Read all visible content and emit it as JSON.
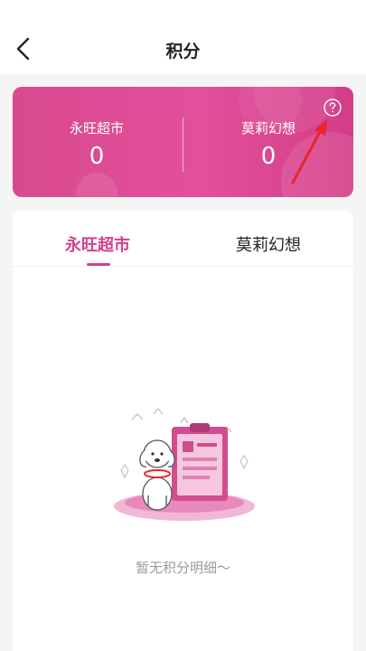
{
  "header": {
    "title": "积分"
  },
  "points_card": {
    "stores": [
      {
        "name": "永旺超市",
        "points": "0"
      },
      {
        "name": "莫莉幻想",
        "points": "0"
      }
    ]
  },
  "tabs": [
    {
      "label": "永旺超市",
      "active": true
    },
    {
      "label": "莫莉幻想",
      "active": false
    }
  ],
  "empty_state": {
    "message": "暂无积分明细～"
  },
  "colors": {
    "brand": "#d63f8b",
    "card_gradient_start": "#d9498f",
    "card_gradient_end": "#d43d88",
    "annotation_arrow": "#e8262c"
  },
  "icons": [
    "back-arrow-icon",
    "help-icon",
    "empty-state-illustration"
  ]
}
